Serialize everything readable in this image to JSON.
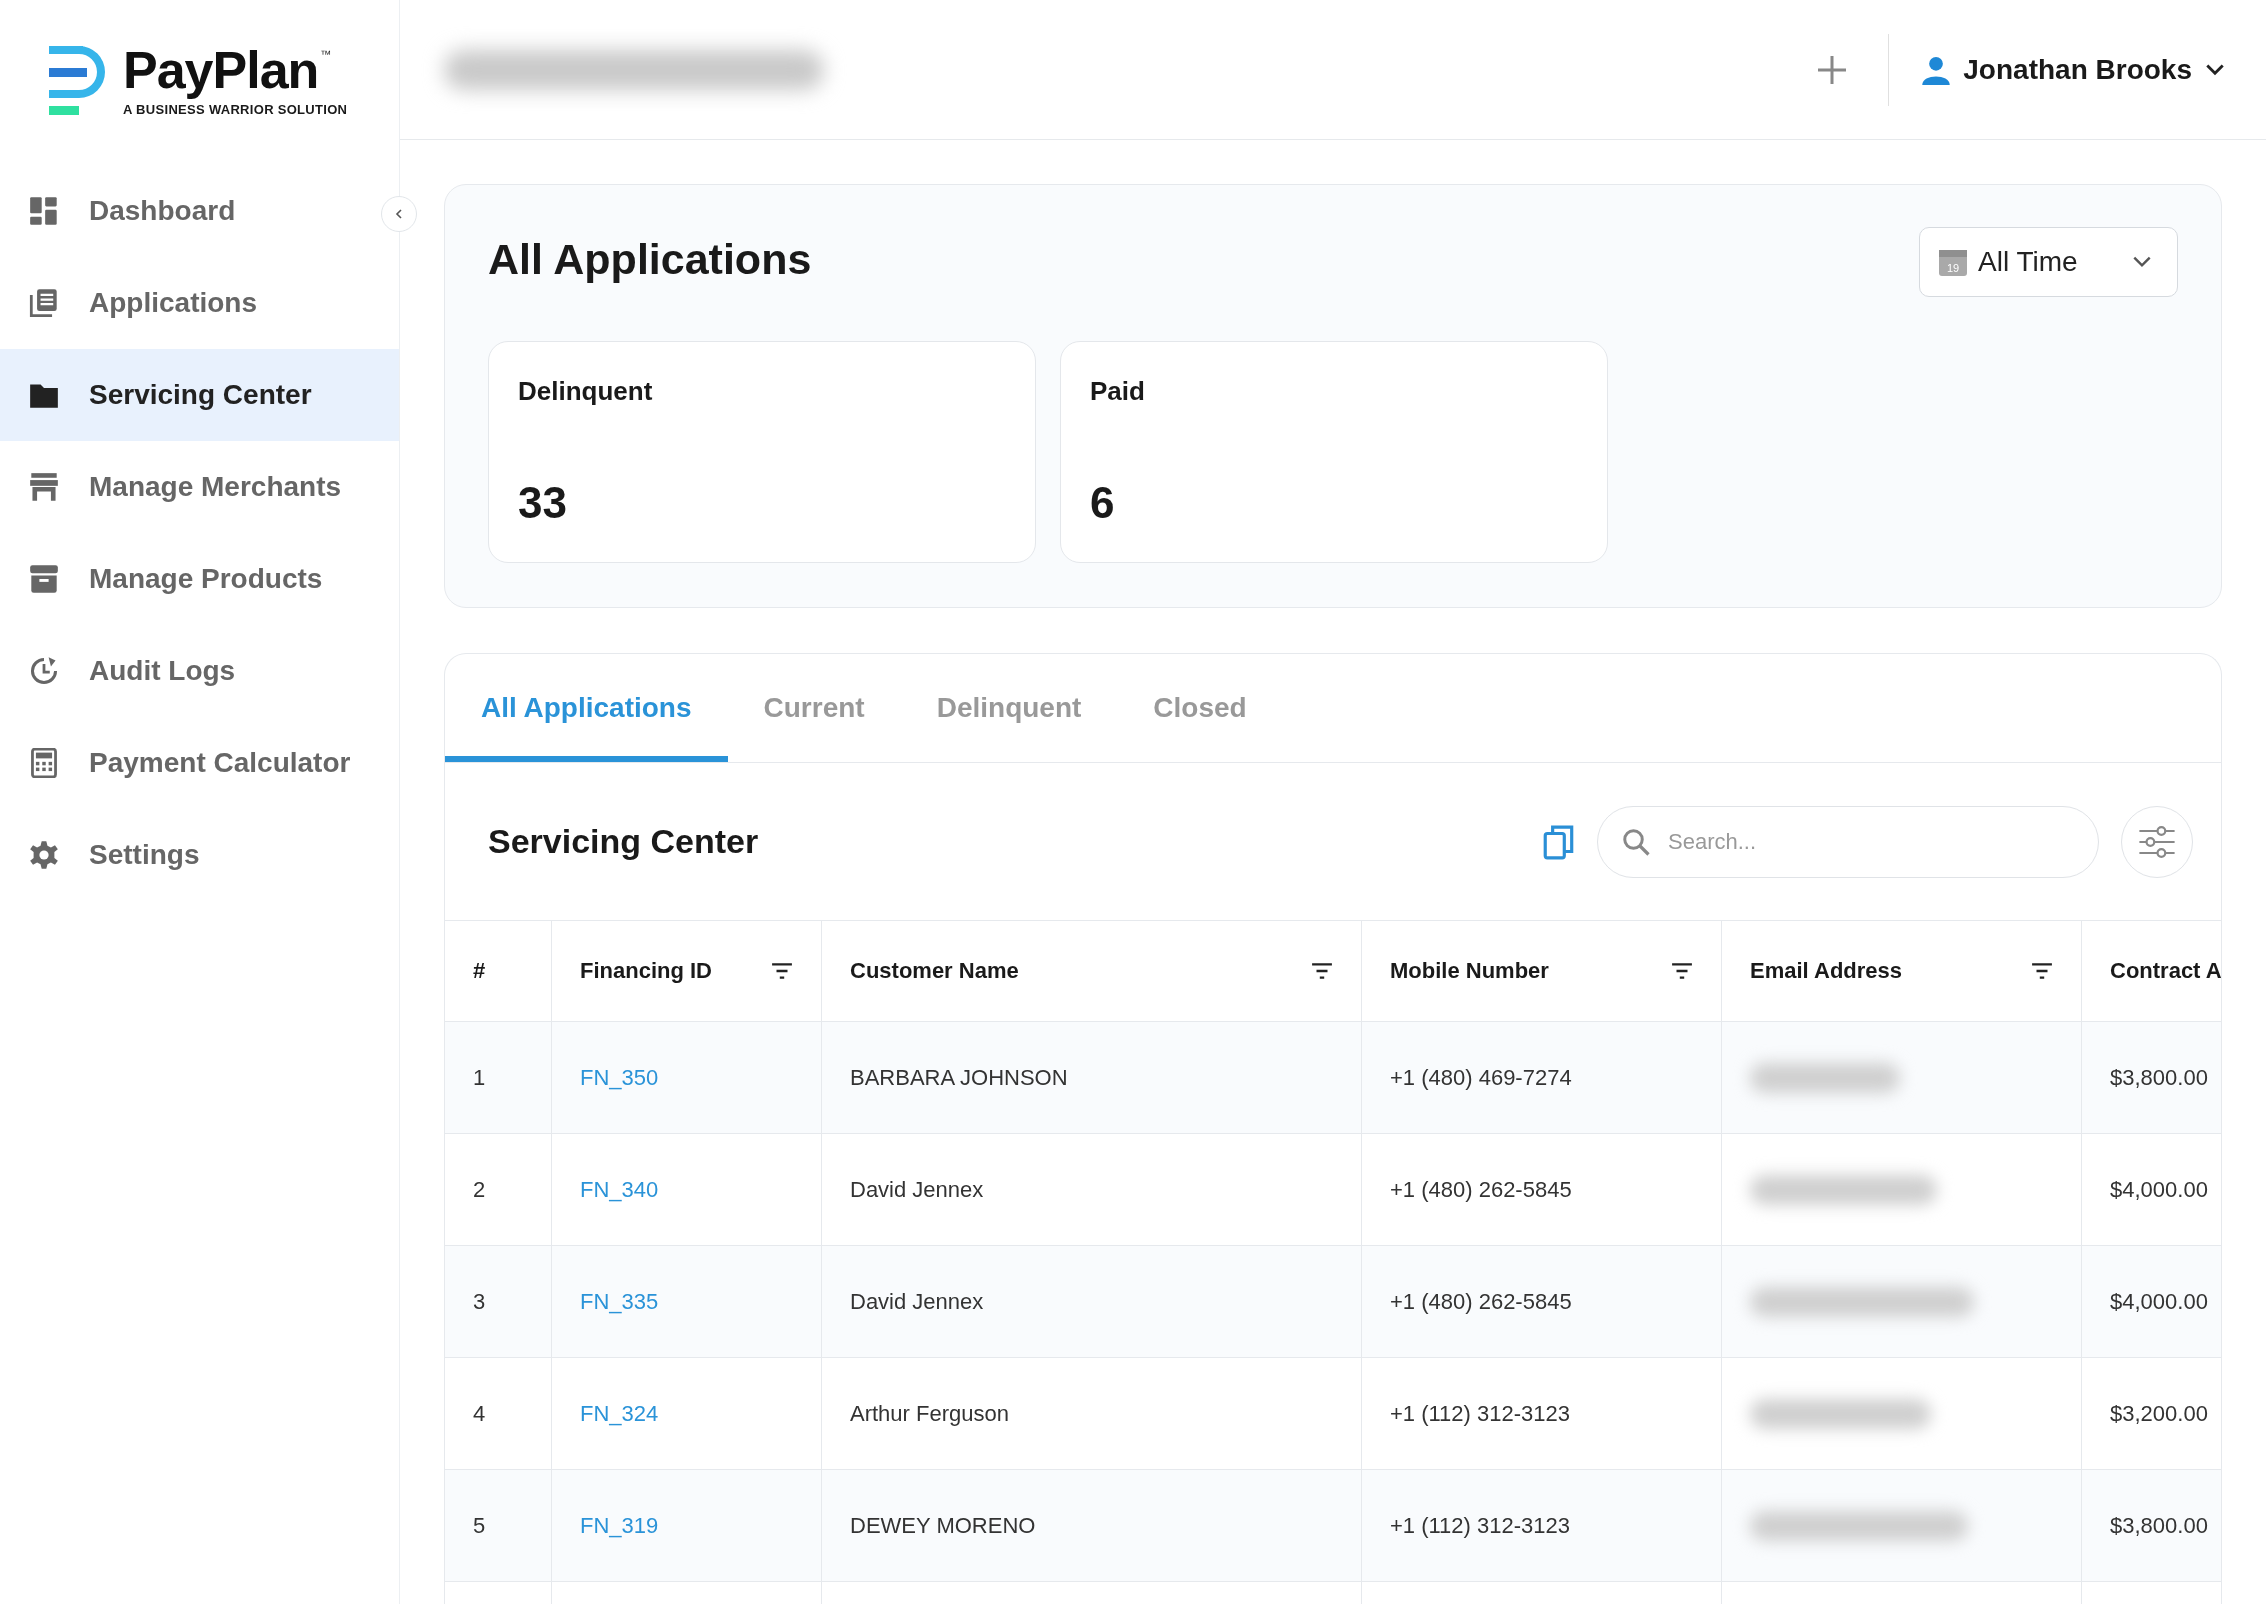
{
  "logo": {
    "name": "PayPlan",
    "trademark": "™",
    "tagline": "A BUSINESS WARRIOR SOLUTION"
  },
  "header": {
    "user": "Jonathan Brooks"
  },
  "sidebar": {
    "items": [
      {
        "label": "Dashboard",
        "selected": false
      },
      {
        "label": "Applications",
        "selected": false
      },
      {
        "label": "Servicing Center",
        "selected": true
      },
      {
        "label": "Manage Merchants",
        "selected": false
      },
      {
        "label": "Manage Products",
        "selected": false
      },
      {
        "label": "Audit Logs",
        "selected": false
      },
      {
        "label": "Payment Calculator",
        "selected": false
      },
      {
        "label": "Settings",
        "selected": false
      }
    ]
  },
  "summary": {
    "title": "All Applications",
    "range": "All Time",
    "calendar_day": "19",
    "cards": [
      {
        "label": "Delinquent",
        "value": "33"
      },
      {
        "label": "Paid",
        "value": "6"
      }
    ]
  },
  "tabs": [
    {
      "label": "All Applications",
      "selected": true
    },
    {
      "label": "Current",
      "selected": false
    },
    {
      "label": "Delinquent",
      "selected": false
    },
    {
      "label": "Closed",
      "selected": false
    }
  ],
  "table": {
    "title": "Servicing Center",
    "search": {
      "placeholder": "Search..."
    },
    "columns": [
      {
        "label": "#",
        "kind": "text",
        "filterable": false
      },
      {
        "label": "Financing ID",
        "kind": "link",
        "filterable": true
      },
      {
        "label": "Customer Name",
        "kind": "text",
        "filterable": true
      },
      {
        "label": "Mobile Number",
        "kind": "text",
        "filterable": true
      },
      {
        "label": "Email Address",
        "kind": "redacted",
        "filterable": true
      },
      {
        "label": "Contract A",
        "kind": "text"
      }
    ],
    "rows": [
      {
        "cells": [
          "1",
          "FN_350",
          "BARBARA JOHNSON",
          "+1 (480) 469-7274",
          "$3,800.00"
        ]
      },
      {
        "cells": [
          "2",
          "FN_340",
          "David Jennex",
          "+1 (480) 262-5845",
          "$4,000.00"
        ]
      },
      {
        "cells": [
          "3",
          "FN_335",
          "David Jennex",
          "+1 (480) 262-5845",
          "$4,000.00"
        ]
      },
      {
        "cells": [
          "4",
          "FN_324",
          "Arthur Ferguson",
          "+1 (112) 312-3123",
          "$3,200.00"
        ]
      },
      {
        "cells": [
          "5",
          "FN_319",
          "DEWEY MORENO",
          "+1 (112) 312-3123",
          "$3,800.00"
        ]
      }
    ]
  }
}
